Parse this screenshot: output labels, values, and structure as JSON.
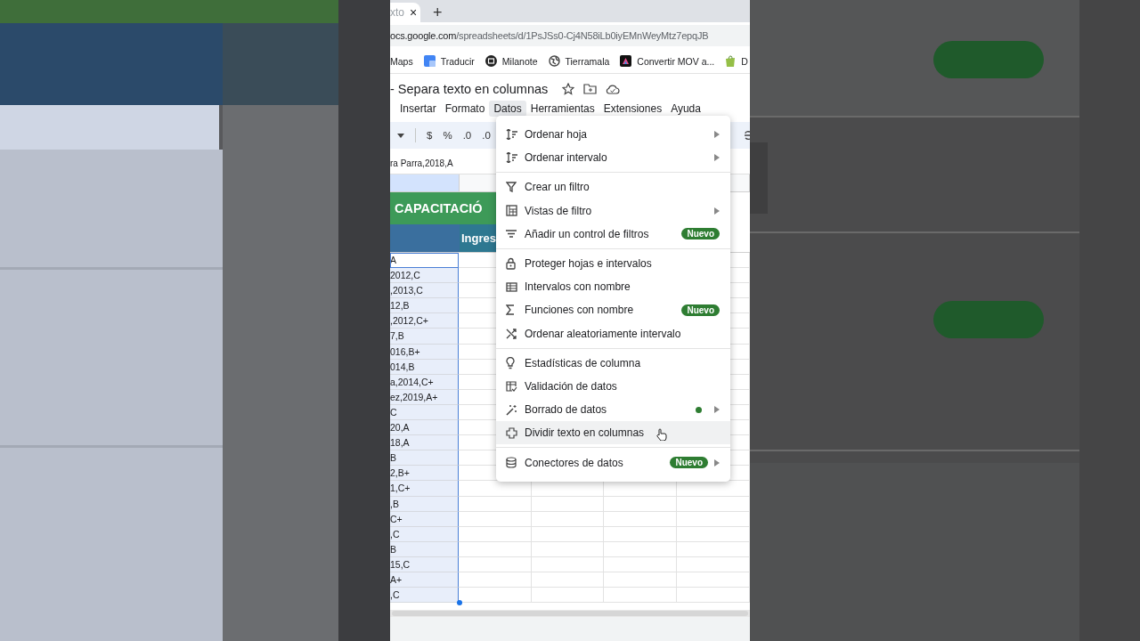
{
  "browser": {
    "tab": {
      "label": "xto",
      "close": "×"
    },
    "new_tab": "+",
    "url": {
      "host": "ocs.google.com",
      "path": "/spreadsheets/d/1PsJSs0-Cj4N58iLb0iyEMnWeyMtz7epqJB"
    },
    "bookmarks": [
      "Maps",
      "Traducir",
      "Milanote",
      "Tierramala",
      "Convertir MOV a...",
      "D"
    ]
  },
  "doc": {
    "title": "- Separa texto en columnas",
    "menu": [
      {
        "label": "Insertar",
        "selected": false
      },
      {
        "label": "Formato",
        "selected": false
      },
      {
        "label": "Datos",
        "selected": true
      },
      {
        "label": "Herramientas",
        "selected": false
      },
      {
        "label": "Extensiones",
        "selected": false
      },
      {
        "label": "Ayuda",
        "selected": false
      }
    ],
    "toolbar": [
      "$",
      "%",
      ".0",
      ".0"
    ],
    "formula": "ra Parra,2018,A"
  },
  "sheet": {
    "banner": "CAPACITACIÓ",
    "header_b": "Ingres",
    "column_a": [
      "A",
      "2012,C",
      ",2013,C",
      "12,B",
      ",2012,C+",
      "7,B",
      "016,B+",
      "014,B",
      "a,2014,C+",
      "ez,2019,A+",
      "C",
      "20,A",
      "18,A",
      "B",
      "2,B+",
      "1,C+",
      ",B",
      "C+",
      ",C",
      "B",
      "15,C",
      "A+",
      ",C"
    ]
  },
  "dropdown": {
    "sections": [
      [
        {
          "label": "Ordenar hoja",
          "submenu": true,
          "dot": false,
          "selected": false
        },
        {
          "label": "Ordenar intervalo",
          "submenu": true,
          "dot": false,
          "selected": false
        }
      ],
      [
        {
          "label": "Crear un filtro",
          "submenu": false,
          "dot": false,
          "selected": false
        },
        {
          "label": "Vistas de filtro",
          "submenu": true,
          "dot": false,
          "selected": false
        },
        {
          "label": "Añadir un control de filtros",
          "submenu": false,
          "badge": "Nuevo",
          "dot": false,
          "selected": false
        }
      ],
      [
        {
          "label": "Proteger hojas e intervalos",
          "submenu": false,
          "dot": false,
          "selected": false
        },
        {
          "label": "Intervalos con nombre",
          "submenu": false,
          "dot": false,
          "selected": false
        },
        {
          "label": "Funciones con nombre",
          "submenu": false,
          "badge": "Nuevo",
          "dot": false,
          "selected": false
        },
        {
          "label": "Ordenar aleatoriamente intervalo",
          "submenu": false,
          "dot": false,
          "selected": false
        }
      ],
      [
        {
          "label": "Estadísticas de columna",
          "submenu": false,
          "dot": false,
          "selected": false
        },
        {
          "label": "Validación de datos",
          "submenu": false,
          "dot": false,
          "selected": false
        },
        {
          "label": "Borrado de datos",
          "submenu": true,
          "dot": true,
          "selected": false
        },
        {
          "label": "Dividir texto en columnas",
          "submenu": false,
          "dot": false,
          "selected": true
        }
      ],
      [
        {
          "label": "Conectores de datos",
          "submenu": true,
          "badge": "Nuevo",
          "dot": false,
          "selected": false
        }
      ]
    ]
  }
}
